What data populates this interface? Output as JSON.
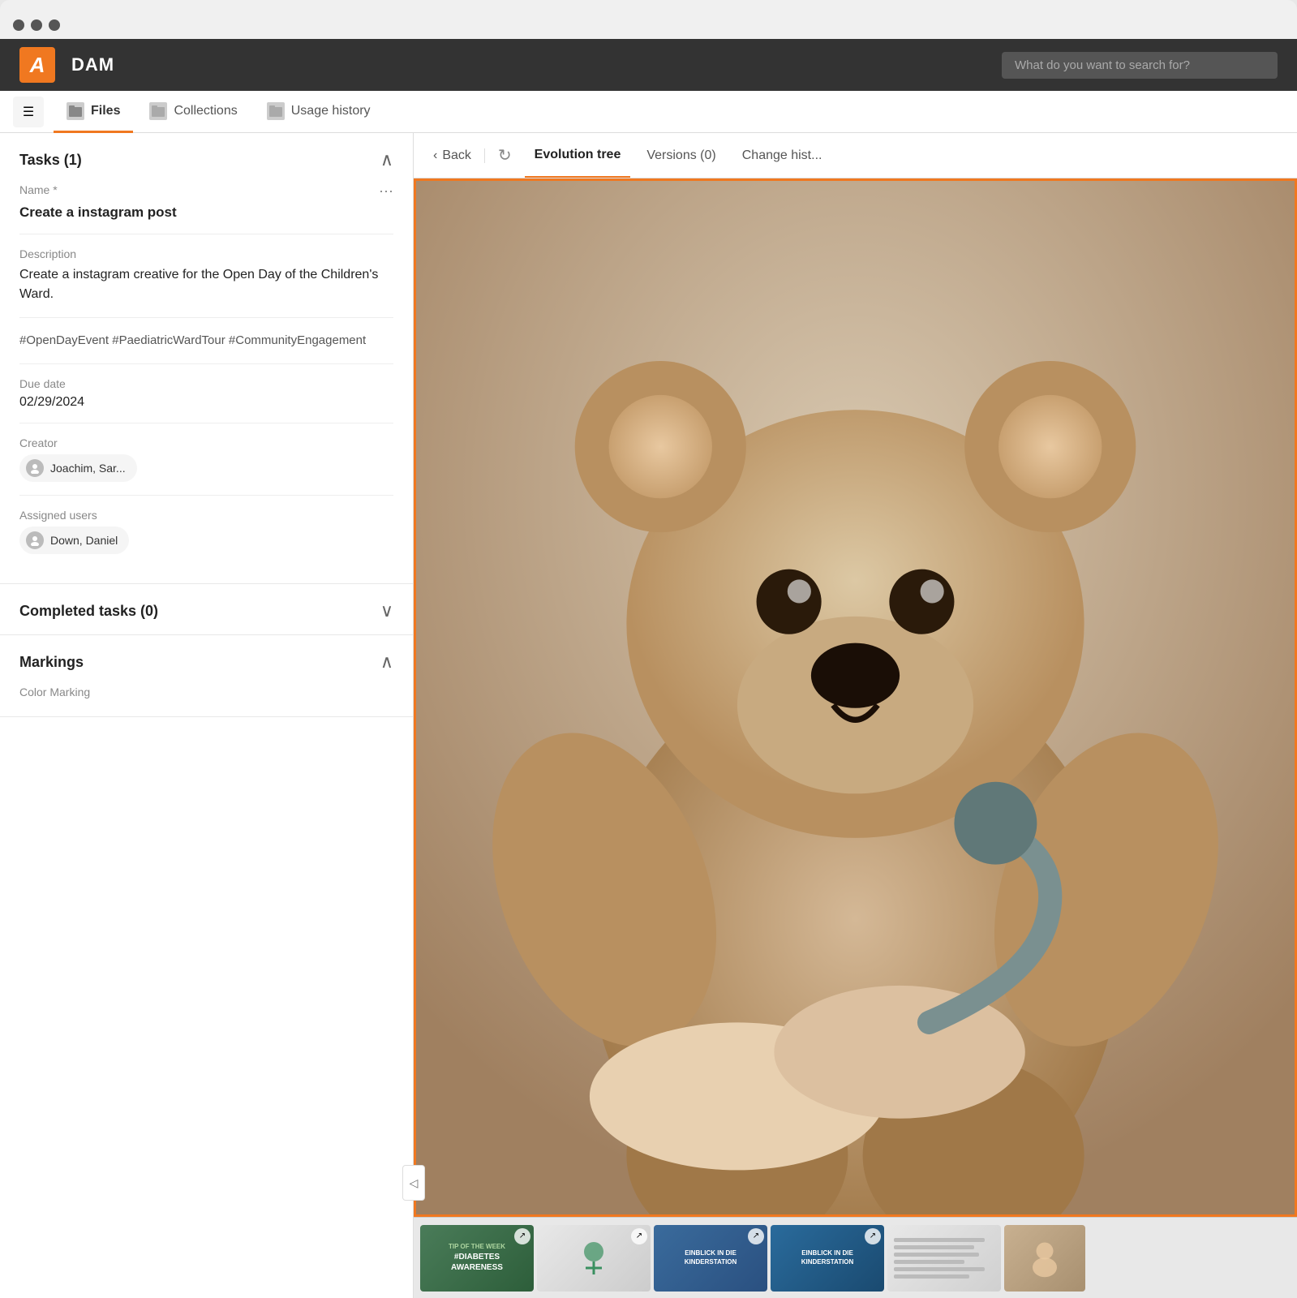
{
  "window": {
    "title": "DAM"
  },
  "topbar": {
    "logo": "A",
    "app_title": "DAM",
    "search_placeholder": "What do you want to search for?"
  },
  "nav": {
    "tabs": [
      {
        "id": "files",
        "label": "Files",
        "active": true
      },
      {
        "id": "collections",
        "label": "Collections",
        "active": false
      },
      {
        "id": "usage-history",
        "label": "Usage history",
        "active": false
      }
    ]
  },
  "left_panel": {
    "tasks_section": {
      "title": "Tasks (1)",
      "toggle": "collapse",
      "name_label": "Name *",
      "name_value": "Create a instagram post",
      "more_options": "⋯",
      "description_label": "Description",
      "description_value": "Create a instagram creative for the Open Day of the Children's Ward.",
      "hashtags": "#OpenDayEvent #PaediatricWardTour #CommunityEngagement",
      "due_date_label": "Due date",
      "due_date_value": "02/29/2024",
      "creator_label": "Creator",
      "creator_value": "Joachim, Sar...",
      "assigned_users_label": "Assigned users",
      "assigned_users_value": "Down, Daniel"
    },
    "completed_tasks": {
      "title": "Completed tasks (0)",
      "toggle": "expand"
    },
    "markings": {
      "title": "Markings",
      "toggle": "collapse",
      "color_marking_label": "Color Marking"
    }
  },
  "right_panel": {
    "back_label": "Back",
    "toolbar_tabs": [
      {
        "id": "evolution-tree",
        "label": "Evolution tree",
        "active": true
      },
      {
        "id": "versions",
        "label": "Versions (0)",
        "active": false
      },
      {
        "id": "change-history",
        "label": "Change hist...",
        "active": false
      }
    ],
    "asset_image_alt": "Teddy bear with stethoscope"
  },
  "filmstrip": {
    "items": [
      {
        "id": 1,
        "type": "green-card",
        "badge": "#DIABETES AWARENESS",
        "has_icon": true
      },
      {
        "id": 2,
        "type": "light-medical",
        "badge": "",
        "has_icon": true
      },
      {
        "id": 3,
        "type": "blue-card-1",
        "badge": "EINBLICK IN DIE KINDERSTATION",
        "has_icon": true
      },
      {
        "id": 4,
        "type": "blue-card-2",
        "badge": "EINBLICK IN DIE KINDERSTATION",
        "has_icon": true
      },
      {
        "id": 5,
        "type": "list-view",
        "badge": "",
        "has_icon": false
      },
      {
        "id": 6,
        "type": "photo",
        "badge": "",
        "has_icon": false
      }
    ]
  },
  "icons": {
    "menu": "☰",
    "files_icon": "🖼",
    "collections_icon": "🖼",
    "usage_icon": "🖼",
    "back_chevron": "‹",
    "refresh": "↻",
    "collapse_up": "∧",
    "expand_down": "∨",
    "panel_collapse": "◁",
    "user_icon": "👤"
  }
}
